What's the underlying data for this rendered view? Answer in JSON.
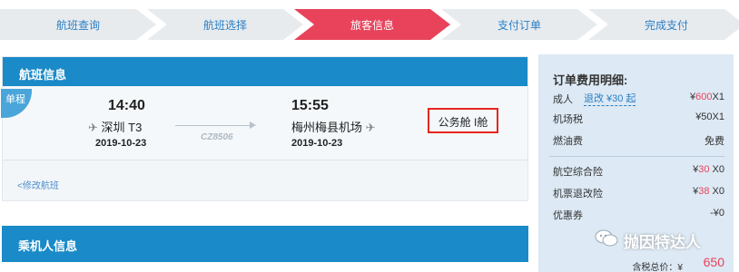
{
  "steps": [
    {
      "label": "航班查询",
      "active": false
    },
    {
      "label": "航班选择",
      "active": false
    },
    {
      "label": "旅客信息",
      "active": true
    },
    {
      "label": "支付订单",
      "active": false
    },
    {
      "label": "完成支付",
      "active": false
    }
  ],
  "flight": {
    "header": "航班信息",
    "trip_type": "单程",
    "depart": {
      "time": "14:40",
      "airport": "深圳 T3",
      "date": "2019-10-23"
    },
    "arrive": {
      "time": "15:55",
      "airport": "梅州梅县机场",
      "date": "2019-10-23"
    },
    "flight_no": "CZ8506",
    "cabin": "公务舱 I舱",
    "modify_link": "<修改航班"
  },
  "passenger": {
    "header": "乘机人信息"
  },
  "order": {
    "title": "订单费用明细:",
    "adult": {
      "label": "成人",
      "refund": "退改 ¥30 起",
      "currency": "¥",
      "amount": "600",
      "qty": "X1"
    },
    "airport_tax": {
      "label": "机场税",
      "value": "¥50X1"
    },
    "fuel": {
      "label": "燃油费",
      "value": "免费"
    },
    "insurance": {
      "label": "航空综合险",
      "currency": "¥",
      "amount": "30",
      "qty": " X0"
    },
    "refund_insurance": {
      "label": "机票退改险",
      "currency": "¥",
      "amount": "38",
      "qty": " X0"
    },
    "coupon": {
      "label": "优惠券",
      "value": "-¥0"
    },
    "total_label": "含税总价：¥",
    "total_value": "650"
  },
  "watermark": {
    "text": "抛因特达人",
    "icon": "wechat-icon"
  },
  "colors": {
    "accent_red": "#e8435b",
    "header_blue": "#1a8ac8",
    "link_blue": "#2a7fc4",
    "highlight_red": "#e8251f"
  }
}
